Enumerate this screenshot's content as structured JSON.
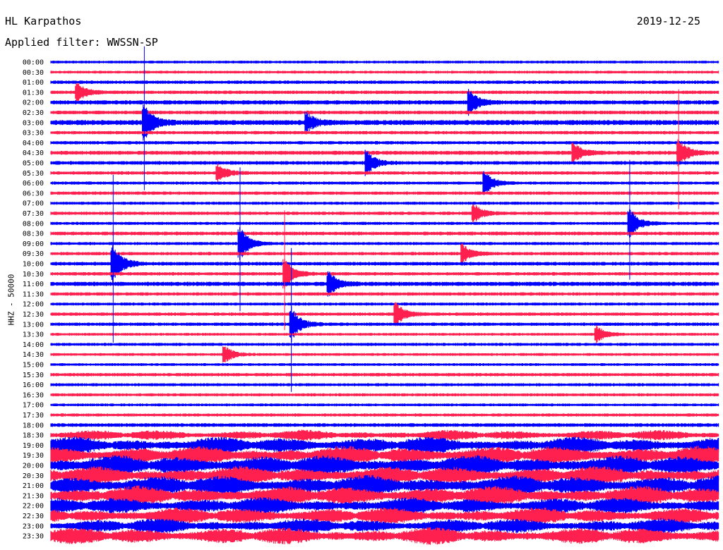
{
  "header": {
    "station": "HL Karpathos",
    "date": "2019-12-25",
    "filter": "Applied filter: WWSSN-SP"
  },
  "chart_data": {
    "type": "line",
    "title": "HL Karpathos",
    "date": "2019-12-25",
    "filter": "Applied filter: WWSSN-SP",
    "ylabel": "HHZ - 50000",
    "row_labels": [
      "00:00",
      "00:30",
      "01:00",
      "01:30",
      "02:00",
      "02:30",
      "03:00",
      "03:30",
      "04:00",
      "04:30",
      "05:00",
      "05:30",
      "06:00",
      "06:30",
      "07:00",
      "07:30",
      "08:00",
      "08:30",
      "09:00",
      "09:30",
      "10:00",
      "10:30",
      "11:00",
      "11:30",
      "12:00",
      "12:30",
      "13:00",
      "13:30",
      "14:00",
      "14:30",
      "15:00",
      "15:30",
      "16:00",
      "16:30",
      "17:00",
      "17:30",
      "18:00",
      "18:30",
      "19:00",
      "19:30",
      "20:00",
      "20:30",
      "21:00",
      "21:30",
      "22:00",
      "22:30",
      "23:00",
      "23:30"
    ],
    "series_colors": [
      "#0000ff",
      "#ff2050"
    ],
    "amplitude_level": [
      1,
      1,
      1.2,
      1.2,
      1.5,
      1.3,
      1.8,
      1.2,
      1.2,
      1.4,
      1.3,
      1.2,
      1.1,
      1.2,
      1.1,
      1.2,
      1.1,
      1.3,
      1.1,
      1.2,
      1.3,
      1.2,
      1.5,
      1.2,
      1.1,
      1.2,
      1.2,
      1,
      1.1,
      1,
      1,
      1.2,
      1.1,
      1.1,
      1,
      1.1,
      1.3,
      2.8,
      4.5,
      5,
      5.5,
      5,
      5.5,
      5.2,
      4.5,
      4.5,
      4,
      4.5
    ],
    "events": [
      {
        "row": 6,
        "time_min": 4.2,
        "strength": 6
      },
      {
        "row": 20,
        "time_min": 2.8,
        "strength": 7
      },
      {
        "row": 18,
        "time_min": 8.5,
        "strength": 6
      },
      {
        "row": 21,
        "time_min": 10.5,
        "strength": 5
      },
      {
        "row": 26,
        "time_min": 10.8,
        "strength": 6
      },
      {
        "row": 22,
        "time_min": 12.5,
        "strength": 4
      },
      {
        "row": 25,
        "time_min": 15.5,
        "strength": 4
      },
      {
        "row": 19,
        "time_min": 18.5,
        "strength": 3
      },
      {
        "row": 12,
        "time_min": 19.5,
        "strength": 4
      },
      {
        "row": 4,
        "time_min": 18.8,
        "strength": 4
      },
      {
        "row": 10,
        "time_min": 14.2,
        "strength": 4
      },
      {
        "row": 29,
        "time_min": 7.8,
        "strength": 3
      },
      {
        "row": 27,
        "time_min": 24.5,
        "strength": 3
      },
      {
        "row": 9,
        "time_min": 23.5,
        "strength": 3
      },
      {
        "row": 16,
        "time_min": 26,
        "strength": 5
      },
      {
        "row": 9,
        "time_min": 28.2,
        "strength": 5
      },
      {
        "row": 3,
        "time_min": 1.2,
        "strength": 3
      },
      {
        "row": 15,
        "time_min": 19,
        "strength": 3
      },
      {
        "row": 6,
        "time_min": 11.5,
        "strength": 3
      },
      {
        "row": 11,
        "time_min": 7.5,
        "strength": 3
      }
    ]
  }
}
